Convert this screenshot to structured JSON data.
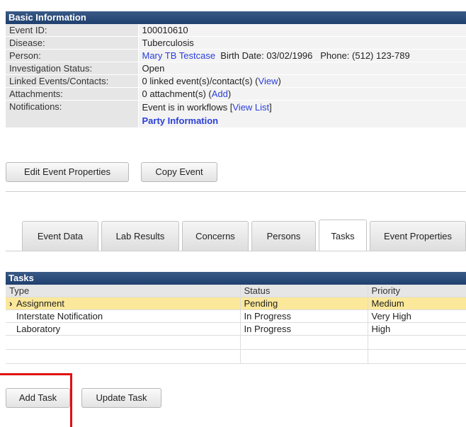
{
  "basic_info": {
    "header": "Basic Information",
    "rows": [
      {
        "label": "Event ID:",
        "value": "100010610"
      },
      {
        "label": "Disease:",
        "value": "Tuberculosis"
      },
      {
        "label": "Person:",
        "person_link": "Mary TB Testcase",
        "person_extra": "Birth Date: 03/02/1996   Phone: (512) 123-789"
      },
      {
        "label": "Investigation Status:",
        "value": "Open"
      },
      {
        "label": "Linked Events/Contacts:",
        "value": "0 linked event(s)/contact(s) (",
        "link": "View",
        "suffix": ")"
      },
      {
        "label": "Attachments:",
        "value": "0 attachment(s) (",
        "link": "Add",
        "suffix": ")"
      },
      {
        "label": "Notifications:",
        "value": "Event is in workflows [",
        "link": "View List",
        "suffix": "]",
        "extra_link": "Party Information"
      }
    ]
  },
  "buttons": {
    "edit_event_properties": "Edit Event Properties",
    "copy_event": "Copy Event",
    "add_task": "Add Task",
    "update_task": "Update Task"
  },
  "tabs": [
    {
      "label": "Event Data",
      "active": false
    },
    {
      "label": "Lab Results",
      "active": false
    },
    {
      "label": "Concerns",
      "active": false
    },
    {
      "label": "Persons",
      "active": false
    },
    {
      "label": "Tasks",
      "active": true
    },
    {
      "label": "Event Properties",
      "active": false
    }
  ],
  "tasks": {
    "header": "Tasks",
    "columns": [
      "Type",
      "Status",
      "Priority"
    ],
    "rows": [
      {
        "type": "Assignment",
        "status": "Pending",
        "priority": "Medium",
        "selected": true
      },
      {
        "type": "Interstate Notification",
        "status": "In Progress",
        "priority": "Very High",
        "selected": false
      },
      {
        "type": "Laboratory",
        "status": "In Progress",
        "priority": "High",
        "selected": false
      }
    ]
  },
  "colors": {
    "header_bg": "#1f3f6e",
    "link": "#2a3fd9",
    "selected_row": "#fbe89a",
    "annotation_red": "#e01010"
  }
}
